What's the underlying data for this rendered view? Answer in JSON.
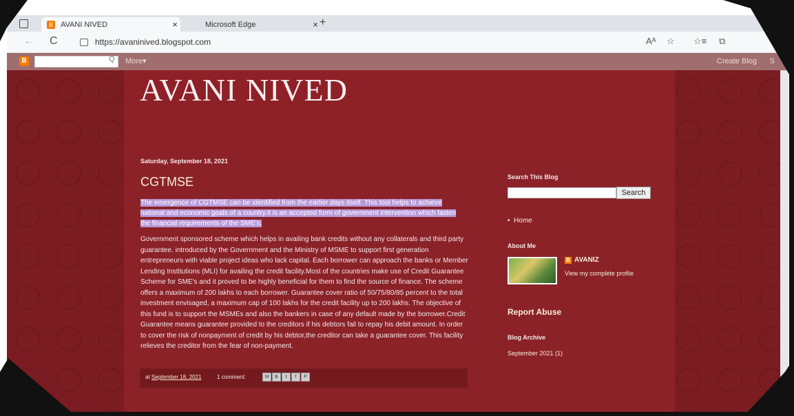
{
  "browser": {
    "tabs": [
      {
        "title": "AVANI NIVED",
        "close": "×"
      },
      {
        "title": "Microsoft Edge",
        "close": "×"
      }
    ],
    "new_tab": "+",
    "url": "https://avaninived.blogspot.com",
    "back_icon": "←",
    "reload_icon": "C",
    "tools": [
      "Aᴬ",
      "☆",
      "☆≡",
      "⧉"
    ]
  },
  "blogger_nav": {
    "logo": "B",
    "search_icon": "Q",
    "more": "More▾",
    "create_blog": "Create Blog",
    "sign_in": "S"
  },
  "blog": {
    "title": "AVANI NIVED"
  },
  "post": {
    "date": "Saturday, September 18, 2021",
    "title": "CGTMSE",
    "highlight": " The emergence of CGTMSE can be identified from the earlier days itself. This tool helps to achieve national and economic goals of a country.it is an accepted form of government intervention which fasten the financial requirements of the SME's.",
    "body": "Government sponsored scheme which helps in availing bank credits without any collaterals and third party guarantee. introduced by the Government and the Ministry of MSME to support first generation entrepreneurs with viable project ideas who lack capital. Each borrower can approach the banks or Member Lending Institutions (MLI) for availing the credit facility.Most of the countries make use of Credit Guarantee Scheme for SME's and it proved to be highly beneficial for them to find the source of finance. The scheme offers a maximum of 200 lakhs to each borrower. Guarantee cover ratio of 50/75/80/85 percent to the total investment envisaged, a maximum cap of 100 lakhs for the credit facility up to 200 lakhs. The objective of this fund is to support the MSMEs and also the bankers in case of any default made by the borrower.Credit Guarantee means guarantee provided to the creditors if his debtors fail to repay his debit amount. In order to cover the risk of nonpayment of credit by his debtor,the creditor can take a guarantee cover. This facility relieves the creditor from the fear of non-payment.",
    "footer_at": "at",
    "footer_date": "September 18, 2021",
    "comments": "1 comment:",
    "share_icons": [
      "M",
      "B",
      "t",
      "f",
      "P"
    ]
  },
  "sidebar": {
    "search_heading": "Search This Blog",
    "search_button": "Search",
    "home_link": "Home",
    "about_heading": "About Me",
    "profile_name": "AVANIZ",
    "profile_link": "View my complete profile",
    "report_abuse": "Report Abuse",
    "archive_heading": "Blog Archive",
    "archive_item": "September 2021 (1)"
  }
}
